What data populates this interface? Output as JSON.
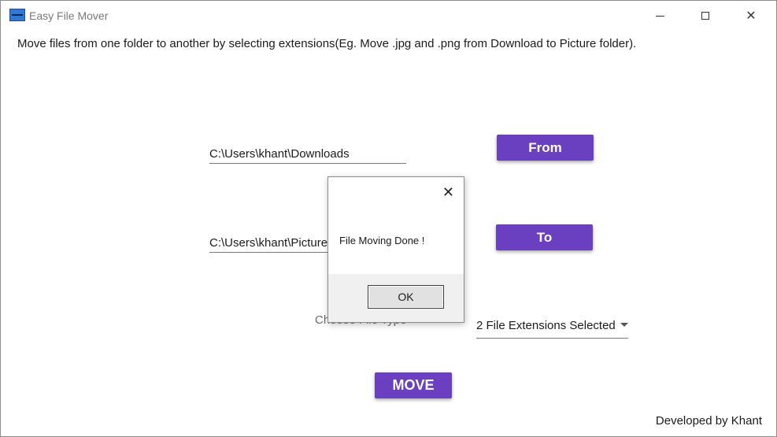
{
  "window": {
    "title": "Easy File Mover",
    "icon": "easy-file-mover-app-icon",
    "minimize_icon": "minimize-icon",
    "maximize_icon": "maximize-icon",
    "close_glyph": "✕"
  },
  "main": {
    "description": "Move files from one folder to another by selecting extensions(Eg. Move  .jpg and .png from Download to Picture folder).",
    "from_path": "C:\\Users\\khant\\Downloads",
    "from_button": "From",
    "to_path": "C:\\Users\\khant\\Pictures",
    "to_button": "To",
    "choose_label": "Choose File Type",
    "extensions_selected": "2 File Extensions Selected",
    "move_button": "MOVE",
    "footer": "Developed by Khant"
  },
  "dialog": {
    "close_glyph": "✕",
    "message": "File Moving Done !",
    "ok_button": "OK"
  },
  "colors": {
    "accent_purple": "#6a3fc0",
    "dialog_footer": "#f0f0f0"
  }
}
